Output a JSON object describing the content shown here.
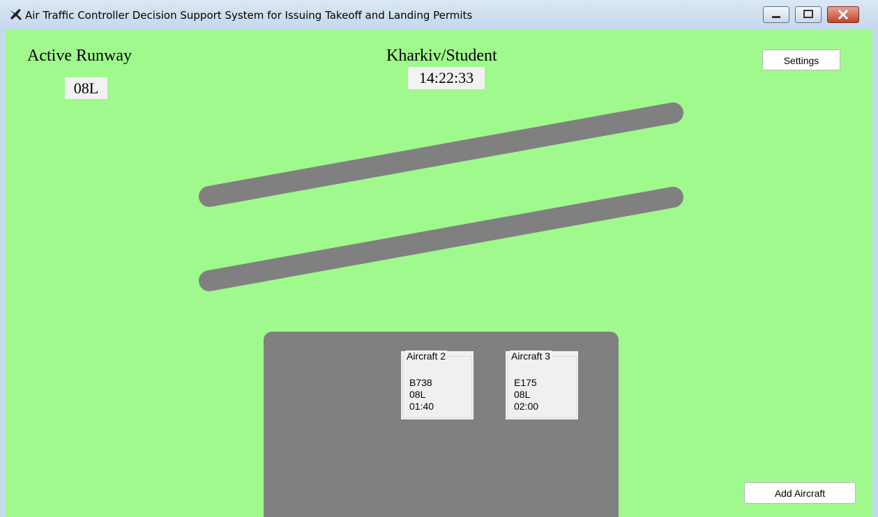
{
  "window": {
    "title": "Air Traffic Controller Decision Support System for Issuing Takeoff and Landing Permits"
  },
  "header": {
    "active_runway_label": "Active Runway",
    "active_runway_value": "08L",
    "airport_label": "Kharkiv/Student",
    "clock": "14:22:33"
  },
  "buttons": {
    "settings": "Settings",
    "add_aircraft": "Add Aircraft"
  },
  "aircraft": [
    {
      "title": "Aircraft 2",
      "type": "B738",
      "runway": "08L",
      "time": "01:40"
    },
    {
      "title": "Aircraft 3",
      "type": "E175",
      "runway": "08L",
      "time": "02:00"
    }
  ],
  "colors": {
    "ground": "#9ff98c",
    "runway": "#808080",
    "apron": "#808080",
    "card": "#f0f0f0"
  }
}
